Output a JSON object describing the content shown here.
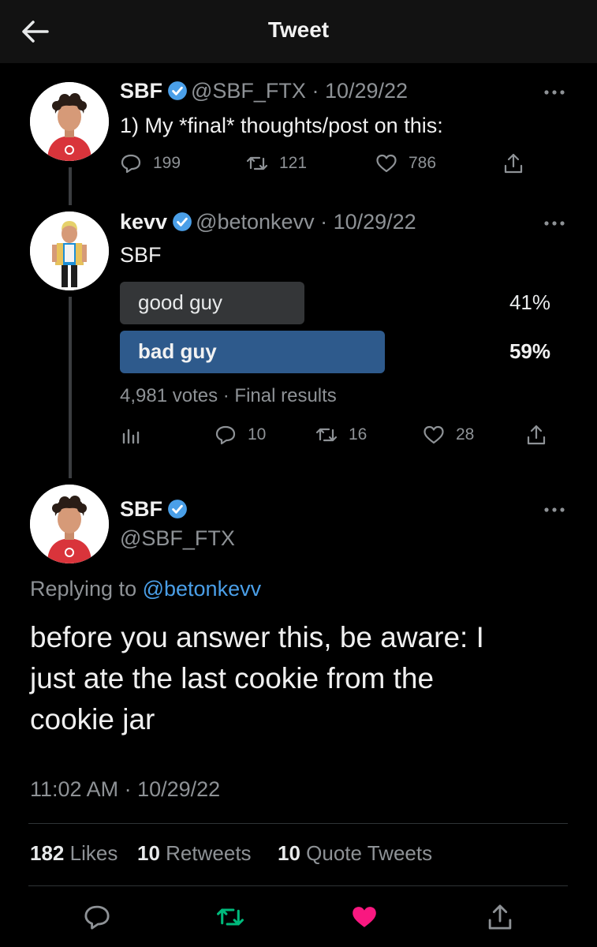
{
  "header": {
    "title": "Tweet"
  },
  "tweet1": {
    "name": "SBF",
    "handle": "@SBF_FTX",
    "date": "· 10/29/22",
    "text": "1) My *final* thoughts/post on this:",
    "replies": "199",
    "retweets": "121",
    "likes": "786"
  },
  "tweet2": {
    "name": "kevv",
    "handle": "@betonkevv",
    "date": "· 10/29/22",
    "text": "SBF",
    "poll": {
      "options": [
        {
          "label": "good guy",
          "percent_text": "41%",
          "percent": 41
        },
        {
          "label": "bad guy",
          "percent_text": "59%",
          "percent": 59
        }
      ],
      "summary": "4,981 votes · Final results"
    },
    "replies": "10",
    "retweets": "16",
    "likes": "28"
  },
  "main": {
    "name": "SBF",
    "handle": "@SBF_FTX",
    "replying_prefix": "Replying to ",
    "replying_to": "@betonkevv",
    "text_lines": [
      "before you answer this, be aware: I",
      "just ate the last cookie from the",
      "cookie jar"
    ],
    "timestamp": "11:02 AM · 10/29/22",
    "stats": {
      "likes_count": "182",
      "likes_label": "Likes",
      "retweets_count": "10",
      "retweets_label": "Retweets",
      "quotes_count": "10",
      "quotes_label": "Quote Tweets"
    }
  },
  "colors": {
    "accent": "#4a9fe8",
    "retweet": "#00ba7c",
    "like": "#f91880",
    "poll_winner": "#2e5a8c",
    "poll_other": "#343638"
  }
}
